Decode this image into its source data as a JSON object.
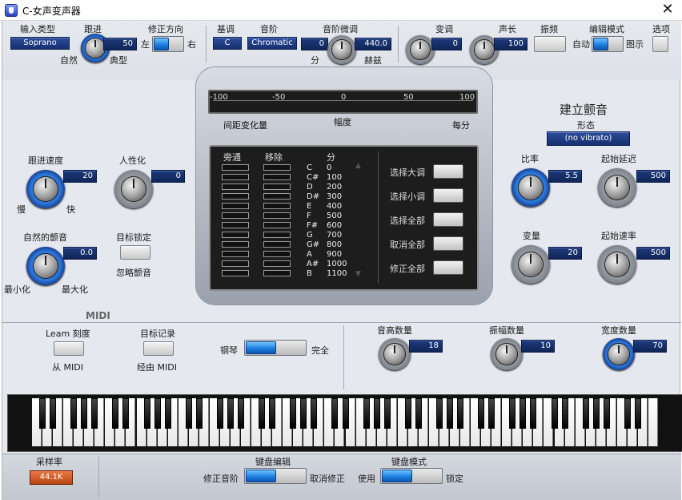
{
  "window": {
    "title": "C-女声变声器",
    "close_glyph": "✕"
  },
  "top": {
    "input_type": {
      "label": "输入类型",
      "value": "Soprano"
    },
    "tracking": {
      "label": "跟进",
      "value": "50",
      "left": "自然",
      "right": "典型"
    },
    "correction_dir": {
      "label": "修正方向",
      "left": "左",
      "right": "右"
    },
    "key": {
      "label": "基调",
      "value": "C"
    },
    "scale": {
      "label": "音阶",
      "value": "Chromatic"
    },
    "fine_tune": {
      "label": "音阶微调",
      "value": "0",
      "hz": "440.0",
      "left": "分",
      "right": "赫兹"
    },
    "transpose": {
      "label": "变调",
      "value": "0"
    },
    "formant": {
      "label": "声长",
      "value": "100"
    },
    "vibrato_btn": {
      "label": "振频"
    },
    "edit_mode": {
      "label": "编辑模式",
      "left": "自动",
      "right": "图示"
    },
    "options": {
      "label": "选项"
    }
  },
  "meter": {
    "ticks": [
      "-100",
      "-50",
      "0",
      "50",
      "100"
    ],
    "left_label": "间距变化量",
    "center_label": "幅度",
    "right_label": "每分"
  },
  "left_panel": {
    "retune_speed": {
      "label": "跟进速度",
      "value": "20",
      "left": "慢",
      "right": "快"
    },
    "humanize": {
      "label": "人性化",
      "value": "0"
    },
    "natural_vibrato": {
      "label": "自然的颤音",
      "value": "0.0",
      "left": "最小化",
      "right": "最大化"
    },
    "target_hold": {
      "label": "目标锁定",
      "sub": "忽略颤音"
    }
  },
  "notes": {
    "col_bypass": "旁通",
    "col_remove": "移除",
    "col_cents": "分",
    "names": [
      "C",
      "C#",
      "D",
      "D#",
      "E",
      "F",
      "F#",
      "G",
      "G#",
      "A",
      "A#",
      "B"
    ],
    "cents": [
      "0",
      "100",
      "200",
      "300",
      "400",
      "500",
      "600",
      "700",
      "800",
      "900",
      "1000",
      "1100"
    ],
    "buttons": [
      "选择大调",
      "选择小调",
      "选择全部",
      "取消全部",
      "修正全部"
    ]
  },
  "vibrato": {
    "title": "建立颤音",
    "shape_label": "形态",
    "shape_value": "(no vibrato)",
    "rate": {
      "label": "比率",
      "value": "5.5"
    },
    "onset_delay": {
      "label": "起始延迟",
      "value": "500"
    },
    "variation": {
      "label": "变量",
      "value": "20"
    },
    "onset_rate": {
      "label": "起始速率",
      "value": "500"
    },
    "pitch_amount": {
      "label": "音高数量",
      "value": "18"
    },
    "amplitude_amount": {
      "label": "振幅数量",
      "value": "10"
    },
    "width_amount": {
      "label": "宽度数量",
      "value": "70"
    }
  },
  "midi": {
    "title": "MIDI",
    "learn": {
      "label": "Leam 刻度",
      "sub": "从 MIDI"
    },
    "target_record": {
      "label": "目标记录",
      "sub": "经由 MIDI"
    },
    "piano": {
      "left": "钢琴",
      "right": "完全"
    }
  },
  "bottom": {
    "sample_rate": {
      "label": "采样率",
      "value": "44.1K"
    },
    "kb_edit": {
      "label": "键盘编辑",
      "left": "修正音阶",
      "right": "取消修正"
    },
    "kb_mode": {
      "label": "键盘模式",
      "left": "使用",
      "right": "锁定"
    }
  }
}
